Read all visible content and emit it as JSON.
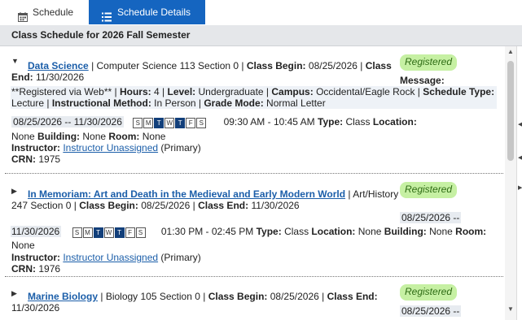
{
  "tabs": {
    "schedule": {
      "label": "Schedule",
      "icon": "calendar-icon"
    },
    "details": {
      "label": "Schedule Details",
      "icon": "list-icon"
    }
  },
  "header": {
    "title": "Class Schedule for 2026 Fall Semester"
  },
  "labels": {
    "class_begin": "Class Begin:",
    "class_end": "Class End:",
    "class": "Class",
    "end": "End:",
    "message": "Message:",
    "hours": "Hours:",
    "level": "Level:",
    "campus": "Campus:",
    "schedule_type": "Schedule Type:",
    "instructional_method": "Instructional Method:",
    "grade_mode": "Grade Mode:",
    "type": "Type:",
    "location": "Location:",
    "building": "Building:",
    "room": "Room:",
    "instructor": "Instructor:",
    "crn": "CRN:"
  },
  "courses": [
    {
      "title": "Data Science",
      "descriptor": "Computer Science 113 Section 0",
      "status": "Registered",
      "class_begin": "08/25/2026",
      "class_end": "11/30/2026",
      "message": "**Registered via Web**",
      "hours": "4",
      "level": "Undergraduate",
      "campus": "Occidental/Eagle Rock",
      "schedule_type": "Lecture",
      "instructional_method": "In Person",
      "grade_mode": "Normal Letter",
      "meeting_dates": "08/25/2026 -- 11/30/2026",
      "meeting_time": "09:30 AM - 10:45 AM",
      "meeting_type": "Class",
      "location": "None",
      "building": "None",
      "room": "None",
      "days": [
        "S",
        "M",
        "T",
        "W",
        "T",
        "F",
        "S"
      ],
      "days_active": [
        false,
        false,
        true,
        false,
        true,
        false,
        false
      ],
      "instructor": "Instructor Unassigned",
      "instructor_role": "(Primary)",
      "crn": "1975",
      "expanded": true
    },
    {
      "title": "In Memoriam: Art and Death in the Medieval and Early Modern World",
      "descriptor": "Art/History 247 Section 0",
      "descriptor_a": "Art/History",
      "descriptor_b": "247 Section 0",
      "status": "Registered",
      "class_begin": "08/25/2026",
      "class_end": "11/30/2026",
      "meeting_dates_start": "08/25/2026 --",
      "meeting_dates_end": "11/30/2026",
      "meeting_time": "01:30 PM - 02:45 PM",
      "meeting_type": "Class",
      "location": "None",
      "building": "None",
      "room": "None",
      "days": [
        "S",
        "M",
        "T",
        "W",
        "T",
        "F",
        "S"
      ],
      "days_active": [
        false,
        false,
        true,
        false,
        true,
        false,
        false
      ],
      "instructor": "Instructor Unassigned",
      "instructor_role": "(Primary)",
      "crn": "1976",
      "expanded": false
    },
    {
      "title": "Marine Biology",
      "descriptor": "Biology 105 Section 0",
      "status": "Registered",
      "class_begin": "08/25/2026",
      "class_end": "11/30/2026",
      "meeting_dates_start": "08/25/2026 --",
      "expanded": false
    }
  ],
  "colors": {
    "tab_active": "#1565c0",
    "link": "#1b5ea9",
    "badge_bg": "#c6f0a3",
    "badge_text": "#2e6b14",
    "day_active": "#123f7a",
    "header_bg": "#e5e7ea"
  }
}
